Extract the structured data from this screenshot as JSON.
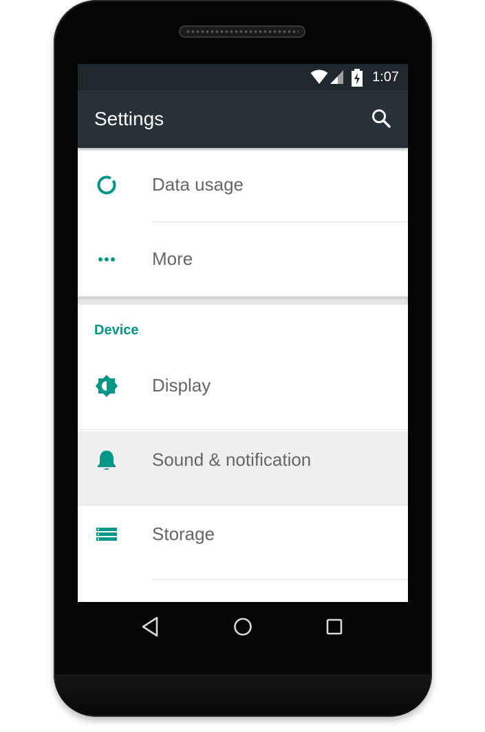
{
  "status_bar": {
    "time": "1:07",
    "icons": [
      "wifi-icon",
      "signal-icon",
      "battery-charging-icon"
    ]
  },
  "app_bar": {
    "title": "Settings",
    "search_icon": "search-icon"
  },
  "wireless_items": [
    {
      "label": "Data usage",
      "icon": "data-usage-icon"
    },
    {
      "label": "More",
      "icon": "more-icon"
    }
  ],
  "device_section": {
    "header": "Device",
    "items": [
      {
        "label": "Display",
        "icon": "display-brightness-icon"
      },
      {
        "label": "Sound & notification",
        "icon": "bell-icon",
        "highlighted": true
      },
      {
        "label": "Storage",
        "icon": "storage-icon"
      }
    ]
  },
  "nav_bar": {
    "buttons": [
      "back-icon",
      "home-icon",
      "recents-icon"
    ]
  },
  "colors": {
    "accent": "#009688",
    "app_bar": "#263238",
    "status_bar": "#1f282c",
    "label_text": "#666666"
  }
}
